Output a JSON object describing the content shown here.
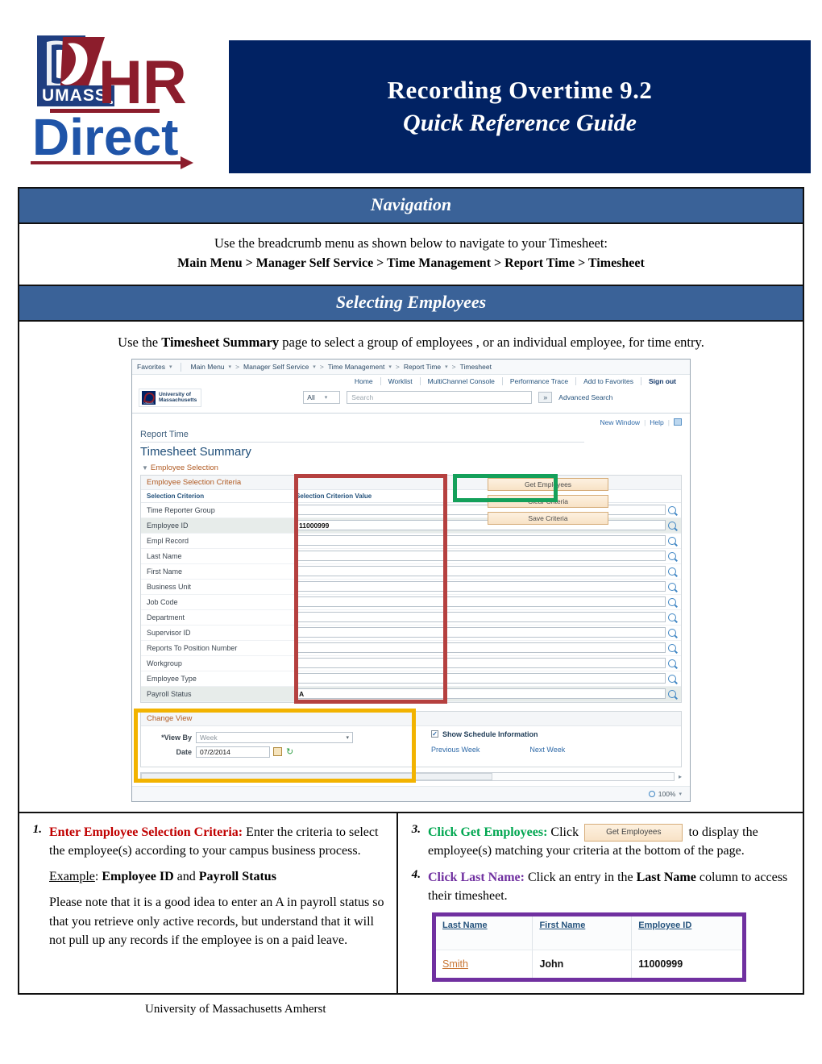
{
  "header": {
    "logo": {
      "umass_text": "UMASS",
      "hr_text": "HR",
      "direct_text": "Direct"
    },
    "title_line1": "Recording Overtime 9.2",
    "title_line2": "Quick Reference Guide",
    "navy": "#012263",
    "band_blue": "#3a6298"
  },
  "navigation": {
    "band_label": "Navigation",
    "intro": "Use the breadcrumb menu as shown below to navigate to your Timesheet:",
    "breadcrumb": "Main Menu > Manager Self Service > Time Management > Report Time > Timesheet"
  },
  "selecting": {
    "band_label": "Selecting Employees",
    "intro_before": "Use the ",
    "intro_bold": "Timesheet Summary",
    "intro_after": " page to select a group of employees , or an individual employee, for time entry."
  },
  "screenshot": {
    "crumbs": [
      "Favorites",
      "Main Menu",
      "Manager Self Service",
      "Time Management",
      "Report Time",
      "Timesheet"
    ],
    "toolbar_links": [
      "Home",
      "Worklist",
      "MultiChannel Console",
      "Performance Trace",
      "Add to Favorites",
      "Sign out"
    ],
    "brand_line1": "University of",
    "brand_line2": "Massachusetts",
    "search_scope": "All",
    "search_placeholder": "Search",
    "advanced_search": "Advanced Search",
    "window_links": [
      "New Window",
      "Help"
    ],
    "report_time": "Report Time",
    "page_title": "Timesheet Summary",
    "employee_selection": "Employee Selection",
    "criteria_title": "Employee Selection Criteria",
    "col_criterion": "Selection Criterion",
    "col_value": "Selection Criterion Value",
    "rows": [
      {
        "label": "Time Reporter Group",
        "value": ""
      },
      {
        "label": "Employee ID",
        "value": "11000999"
      },
      {
        "label": "Empl Record",
        "value": ""
      },
      {
        "label": "Last Name",
        "value": ""
      },
      {
        "label": "First Name",
        "value": ""
      },
      {
        "label": "Business Unit",
        "value": ""
      },
      {
        "label": "Job Code",
        "value": ""
      },
      {
        "label": "Department",
        "value": ""
      },
      {
        "label": "Supervisor ID",
        "value": ""
      },
      {
        "label": "Reports To Position Number",
        "value": ""
      },
      {
        "label": "Workgroup",
        "value": ""
      },
      {
        "label": "Employee Type",
        "value": ""
      },
      {
        "label": "Payroll Status",
        "value": "A"
      }
    ],
    "buttons": [
      "Get Employees",
      "Clear Criteria",
      "Save Criteria"
    ],
    "change_view": {
      "title": "Change View",
      "view_by_label": "*View By",
      "view_by_value": "Week",
      "date_label": "Date",
      "date_value": "07/2/2014",
      "show_schedule": "Show Schedule Information",
      "previous_week": "Previous Week",
      "next_week": "Next Week"
    },
    "zoom_level": "100%",
    "highlight_colors": {
      "criteria": "#b5403f",
      "get_employees": "#14a05a",
      "change_view": "#f2b300"
    }
  },
  "steps": {
    "step1": {
      "number": "1.",
      "lead": "Enter Employee Selection Criteria:",
      "body": " Enter the criteria to select the employee(s) according to your campus business process.",
      "example_label": "Example",
      "example_sep": ":  ",
      "example_b1": "Employee ID",
      "example_mid": " and ",
      "example_b2": "Payroll Status",
      "note": "Please note that it is a good idea to enter an A in payroll status so that you retrieve only active records, but understand that it will not pull up any records if the employee  is on a paid leave."
    },
    "step3": {
      "number": "3.",
      "lead": "Click Get Employees:",
      "body_before": " Click ",
      "button_label": "Get Employees",
      "body_after": " to display the employee(s) matching your criteria at the bottom of the page."
    },
    "step4": {
      "number": "4.",
      "lead": "Click Last Name:",
      "body_before": " Click an entry in the ",
      "body_bold": "Last Name",
      "body_after": " column to access their timesheet."
    },
    "employee_table": {
      "headers": [
        "Last Name",
        "First Name",
        "Employee ID"
      ],
      "row": {
        "last_name": "Smith",
        "first_name": "John",
        "employee_id": "11000999"
      },
      "border_color": "#7030a0"
    }
  },
  "footer": {
    "text": "University of Massachusetts Amherst"
  }
}
